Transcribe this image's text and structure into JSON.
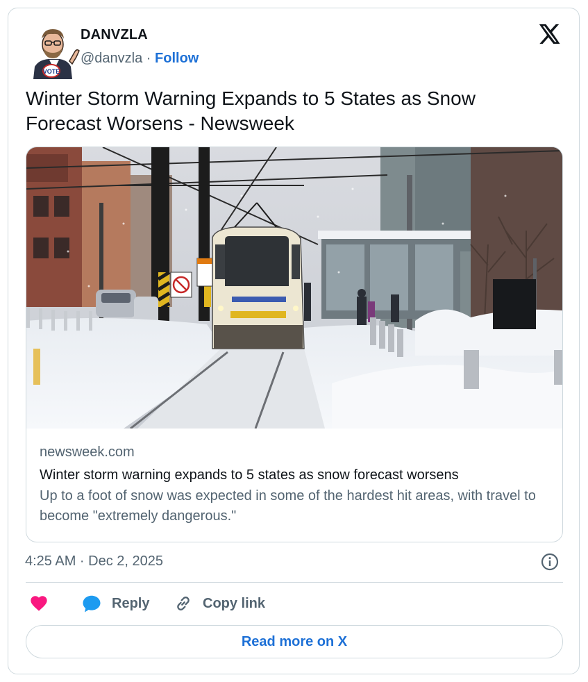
{
  "author": {
    "name": "DANVZLA",
    "handle": "@danvzla",
    "separator": " · ",
    "follow_label": "Follow",
    "avatar_badge": "VOTE"
  },
  "platform_icon": "x-logo-icon",
  "tweet": {
    "text": "Winter Storm Warning Expands to 5 States as Snow Forecast Worsens - Newsweek"
  },
  "link_card": {
    "image_icon": "snowy-streetcar-photo",
    "domain": "newsweek.com",
    "title": "Winter storm warning expands to 5 states as snow forecast worsens",
    "description": "Up to a foot of snow was expected in some of the hardest hit areas, with travel to become \"extremely dangerous.\""
  },
  "timestamp": "4:25 AM · Dec 2, 2025",
  "actions": {
    "like_icon": "heart-icon",
    "reply_label": "Reply",
    "copy_label": "Copy link"
  },
  "read_more_label": "Read more on X",
  "colors": {
    "accent": "#1d70d6",
    "like": "#f91880",
    "reply_icon": "#1d9bf0",
    "secondary_text": "#536471",
    "border": "#cfd9de"
  }
}
